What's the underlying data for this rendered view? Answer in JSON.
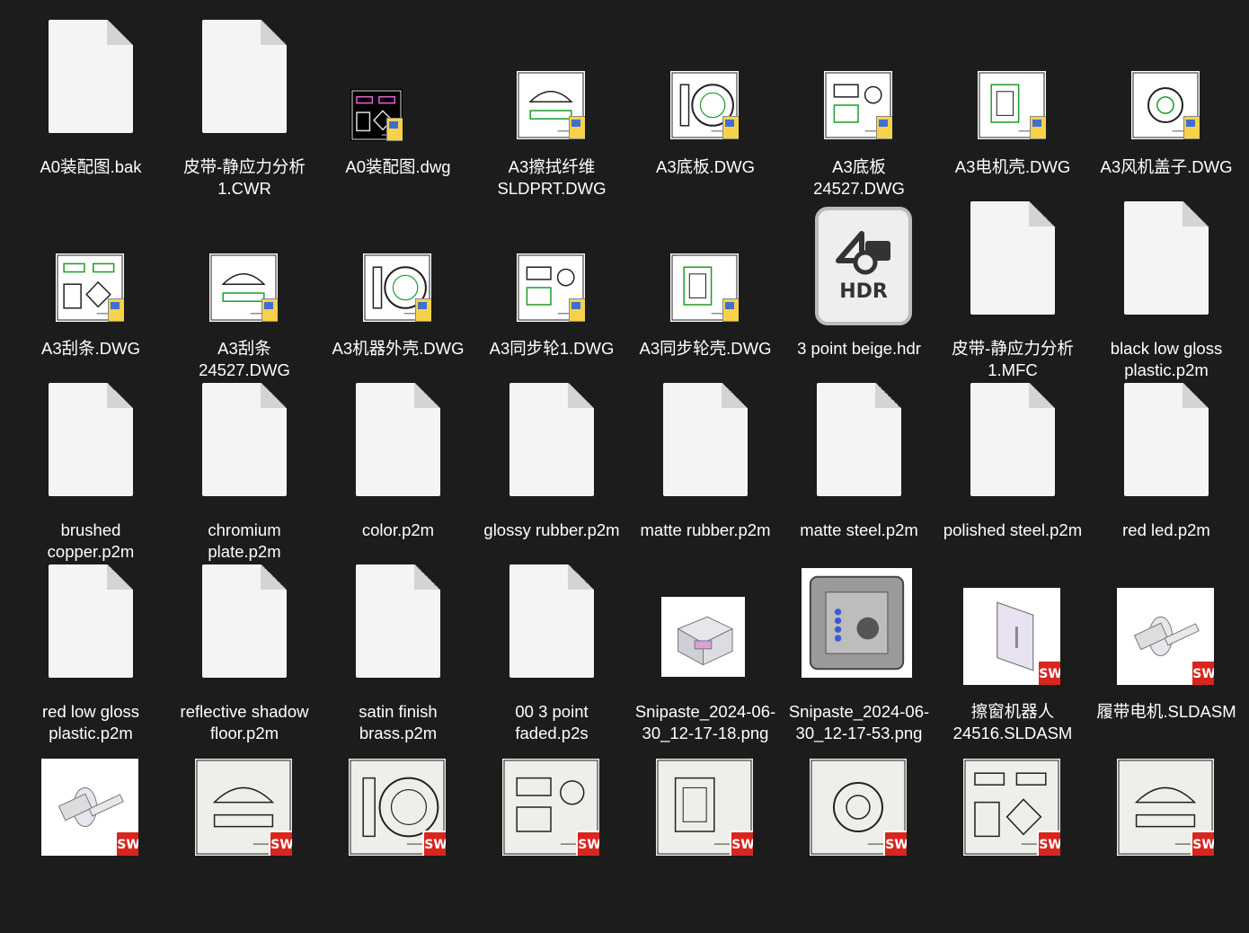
{
  "files": [
    {
      "name": "A0装配图.bak",
      "icon": "blank-file-icon"
    },
    {
      "name": "皮带-静应力分析1.CWR",
      "icon": "blank-file-icon"
    },
    {
      "name": "A0装配图.dwg",
      "icon": "dwg-thumbnail"
    },
    {
      "name": "A3擦拭纤维SLDPRT.DWG",
      "icon": "dwg-thumbnail"
    },
    {
      "name": "A3底板.DWG",
      "icon": "dwg-thumbnail"
    },
    {
      "name": "A3底板24527.DWG",
      "icon": "dwg-thumbnail"
    },
    {
      "name": "A3电机壳.DWG",
      "icon": "dwg-thumbnail"
    },
    {
      "name": "A3风机盖子.DWG",
      "icon": "dwg-thumbnail"
    },
    {
      "name": "A3刮条.DWG",
      "icon": "dwg-thumbnail"
    },
    {
      "name": "A3刮条24527.DWG",
      "icon": "dwg-thumbnail"
    },
    {
      "name": "A3机器外壳.DWG",
      "icon": "dwg-thumbnail"
    },
    {
      "name": "A3同步轮1.DWG",
      "icon": "dwg-thumbnail"
    },
    {
      "name": "A3同步轮壳.DWG",
      "icon": "dwg-thumbnail"
    },
    {
      "name": "3 point beige.hdr",
      "icon": "hdr-file-icon",
      "icon_text": "HDR"
    },
    {
      "name": "皮带-静应力分析1.MFC",
      "icon": "blank-file-icon"
    },
    {
      "name": "black low gloss plastic.p2m",
      "icon": "blank-file-icon"
    },
    {
      "name": "brushed copper.p2m",
      "icon": "blank-file-icon"
    },
    {
      "name": "chromium plate.p2m",
      "icon": "blank-file-icon"
    },
    {
      "name": "color.p2m",
      "icon": "blank-file-icon"
    },
    {
      "name": "glossy rubber.p2m",
      "icon": "blank-file-icon"
    },
    {
      "name": "matte rubber.p2m",
      "icon": "blank-file-icon"
    },
    {
      "name": "matte steel.p2m",
      "icon": "blank-file-icon"
    },
    {
      "name": "polished steel.p2m",
      "icon": "blank-file-icon"
    },
    {
      "name": "red led.p2m",
      "icon": "blank-file-icon"
    },
    {
      "name": "red low gloss plastic.p2m",
      "icon": "blank-file-icon"
    },
    {
      "name": "reflective shadow floor.p2m",
      "icon": "blank-file-icon"
    },
    {
      "name": "satin finish brass.p2m",
      "icon": "blank-file-icon"
    },
    {
      "name": "00 3 point faded.p2s",
      "icon": "blank-file-icon"
    },
    {
      "name": "Snipaste_2024-06-30_12-17-18.png",
      "icon": "image-thumbnail"
    },
    {
      "name": "Snipaste_2024-06-30_12-17-53.png",
      "icon": "image-thumbnail"
    },
    {
      "name": "擦窗机器人24516.SLDASM",
      "icon": "sldasm-thumbnail",
      "badge_text": "SW"
    },
    {
      "name": "履带电机.SLDASM",
      "icon": "sldasm-thumbnail",
      "badge_text": "SW"
    },
    {
      "name": "",
      "icon": "sldasm-thumbnail",
      "badge_text": "SW"
    },
    {
      "name": "",
      "icon": "slddrw-thumbnail",
      "badge_text": "SW"
    },
    {
      "name": "",
      "icon": "slddrw-thumbnail",
      "badge_text": "SW"
    },
    {
      "name": "",
      "icon": "slddrw-thumbnail",
      "badge_text": "SW"
    },
    {
      "name": "",
      "icon": "slddrw-thumbnail",
      "badge_text": "SW"
    },
    {
      "name": "",
      "icon": "slddrw-thumbnail",
      "badge_text": "SW"
    },
    {
      "name": "",
      "icon": "slddrw-thumbnail",
      "badge_text": "SW"
    },
    {
      "name": "",
      "icon": "slddrw-thumbnail",
      "badge_text": "SW"
    }
  ]
}
